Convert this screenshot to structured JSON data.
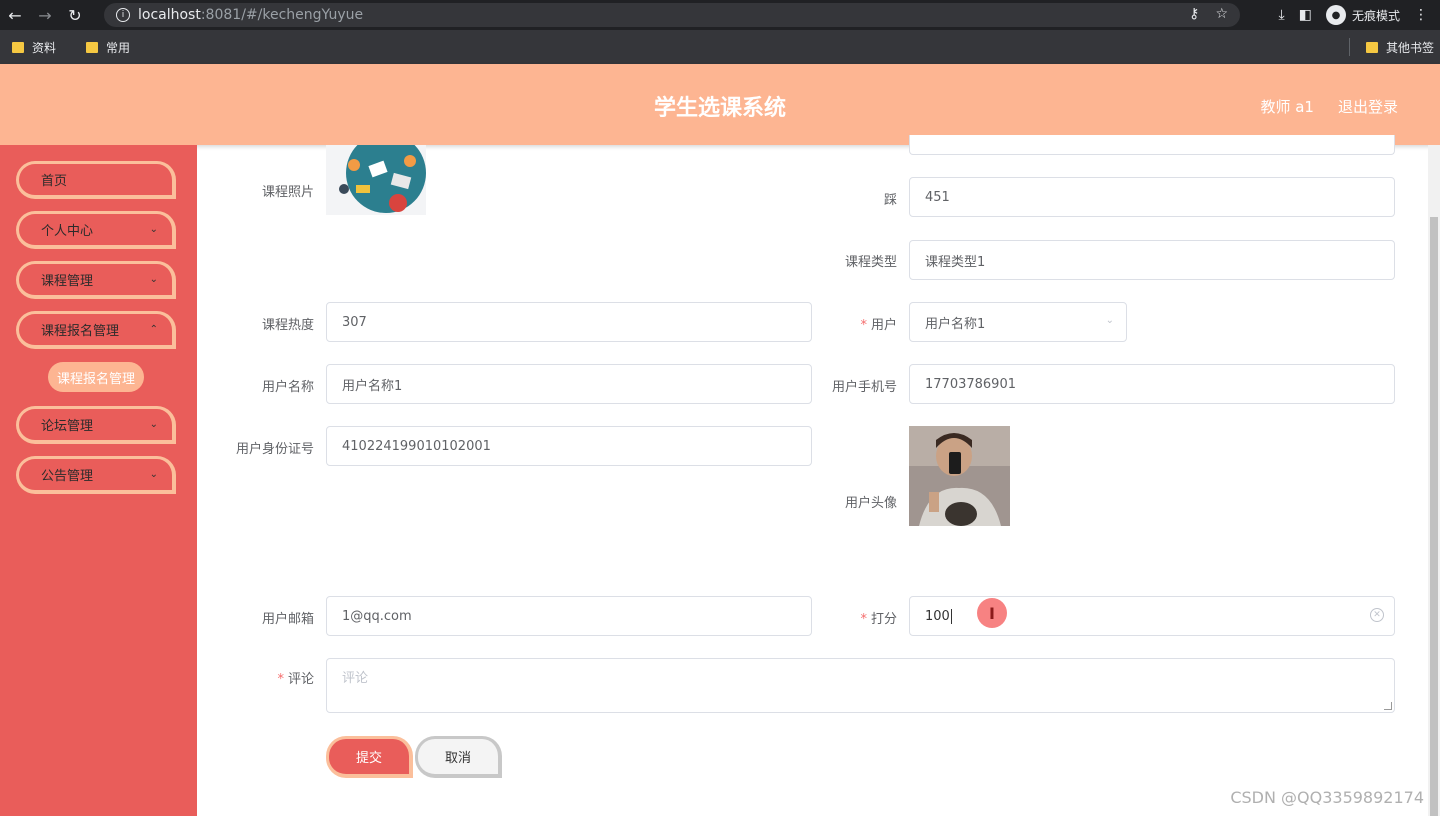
{
  "browser": {
    "url_host": "localhost",
    "url_path": ":8081/#/kechengYuyue",
    "incognito_label": "无痕模式",
    "bookmarks": [
      "资料",
      "常用"
    ],
    "other_bookmarks": "其他书签"
  },
  "header": {
    "title": "学生选课系统",
    "user": "教师 a1",
    "logout": "退出登录"
  },
  "sidebar": {
    "items": [
      {
        "label": "首页"
      },
      {
        "label": "个人中心"
      },
      {
        "label": "课程管理"
      },
      {
        "label": "课程报名管理"
      },
      {
        "label": "论坛管理"
      },
      {
        "label": "公告管理"
      }
    ],
    "active_sub": "课程报名管理"
  },
  "form": {
    "course_photo_label": "课程照片",
    "classroom_label": "踩",
    "classroom_value": "451",
    "course_type_label": "课程类型",
    "course_type_value": "课程类型1",
    "heat_label": "课程热度",
    "heat_value": "307",
    "user_label": "用户",
    "user_value": "用户名称1",
    "username_label": "用户名称",
    "username_value": "用户名称1",
    "phone_label": "用户手机号",
    "phone_value": "17703786901",
    "idcard_label": "用户身份证号",
    "idcard_value": "410224199010102001",
    "avatar_label": "用户头像",
    "email_label": "用户邮箱",
    "email_value": "1@qq.com",
    "score_label": "打分",
    "score_value": "100",
    "comment_label": "评论",
    "comment_placeholder": "评论",
    "submit": "提交",
    "cancel": "取消"
  },
  "watermark": "CSDN @QQ3359892174",
  "colors": {
    "header": "#fdb592",
    "sidebar": "#e95d5a",
    "accent_border": "#fbbf9b",
    "required": "#f56c6c"
  }
}
